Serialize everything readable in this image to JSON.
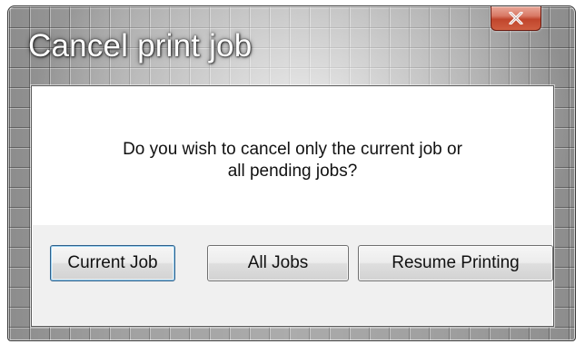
{
  "dialog": {
    "title": "Cancel print job",
    "message_line1": "Do you wish to cancel only the current job or",
    "message_line2": "all pending jobs?",
    "close_label": "X"
  },
  "buttons": {
    "current_job": "Current Job",
    "all_jobs": "All Jobs",
    "resume_printing": "Resume Printing"
  },
  "icons": {
    "close": "close-icon"
  },
  "colors": {
    "close_button": "#c0452c",
    "default_button_border": "#2d5f8a",
    "button_area": "#f0f0f0"
  }
}
